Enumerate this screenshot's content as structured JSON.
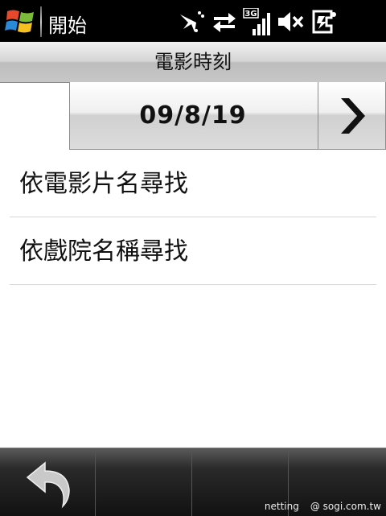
{
  "statusbar": {
    "start_label": "開始",
    "start_icon": "windows-flag-icon",
    "network_badge": "3G",
    "icons": [
      "sync-disconnected-icon",
      "data-transfer-icon",
      "signal-3g-icon",
      "volume-muted-icon",
      "battery-charging-icon"
    ]
  },
  "header": {
    "title": "電影時刻"
  },
  "datebar": {
    "date": "09/8/19",
    "next_icon": "chevron-right-icon"
  },
  "menu": {
    "items": [
      {
        "label": "依電影片名尋找"
      },
      {
        "label": "依戲院名稱尋找"
      }
    ]
  },
  "softkeys": {
    "back_icon": "back-arrow-icon"
  },
  "watermark": {
    "left": "netting",
    "right": "@ sogi.com.tw"
  },
  "colors": {
    "statusbar": "#000000",
    "softbar": "#1a1a1a",
    "text": "#111111"
  }
}
